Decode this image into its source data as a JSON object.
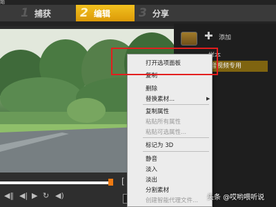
{
  "window": {
    "title_fragment": "始"
  },
  "steps": [
    {
      "num": "1",
      "label": "捕获"
    },
    {
      "num": "2",
      "label": "编辑"
    },
    {
      "num": "3",
      "label": "分享"
    }
  ],
  "panel": {
    "add_label": "添加",
    "sample_label": "样本",
    "highlighted_item": "音视频专用"
  },
  "context_menu": {
    "items": [
      {
        "label": "打开选项面板",
        "disabled": false
      },
      {
        "label": "复制",
        "disabled": false
      },
      {
        "label": "删除",
        "disabled": false
      },
      {
        "label": "替换素材...",
        "disabled": false,
        "submenu": true
      },
      {
        "label": "复制属性",
        "disabled": false
      },
      {
        "label": "粘贴所有属性",
        "disabled": true
      },
      {
        "label": "粘贴可选属性...",
        "disabled": true
      },
      {
        "label": "标记为 3D",
        "disabled": false
      },
      {
        "label": "静音",
        "disabled": false
      },
      {
        "label": "淡入",
        "disabled": false
      },
      {
        "label": "淡出",
        "disabled": false
      },
      {
        "label": "分割素材",
        "disabled": false
      },
      {
        "label": "创建智能代理文件...",
        "disabled": true
      }
    ]
  },
  "watermark": "头条 @哎哟喂听说",
  "colors": {
    "accent_tab": "#f2c11f",
    "highlight": "#e31e1e",
    "scrub_handle": "#ef7a12"
  }
}
